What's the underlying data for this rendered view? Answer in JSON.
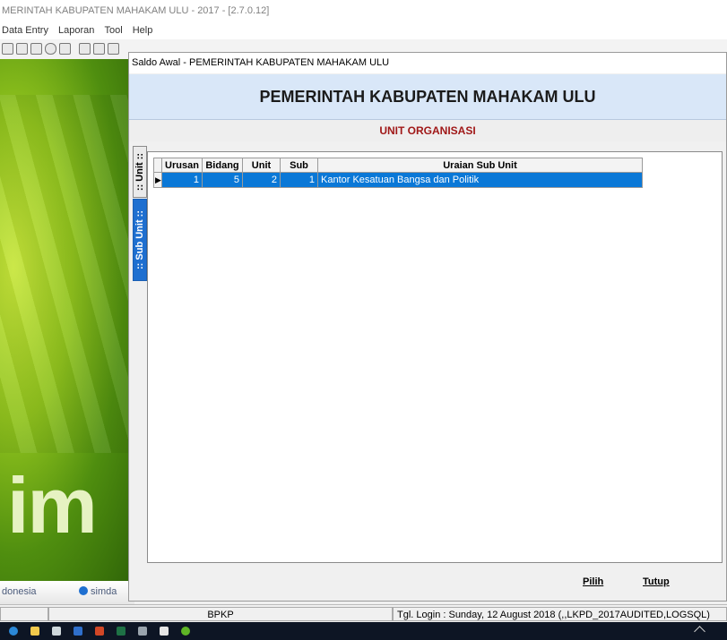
{
  "app": {
    "title": "MERINTAH KABUPATEN MAHAKAM ULU - 2017 - [2.7.0.12]",
    "menu": [
      "Data Entry",
      "Laporan",
      "Tool",
      "Help"
    ]
  },
  "desktop": {
    "logo_text": "im",
    "footer_left": "donesia",
    "footer_right": "simda"
  },
  "dialog": {
    "title": "Saldo Awal - PEMERINTAH KABUPATEN MAHAKAM ULU",
    "header": "PEMERINTAH KABUPATEN MAHAKAM ULU",
    "section": "UNIT ORGANISASI",
    "tabs": [
      ":: Unit ::",
      ":: Sub Unit ::"
    ],
    "active_tab": ":: Sub Unit ::",
    "grid": {
      "columns": [
        "Urusan",
        "Bidang",
        "Unit",
        "Sub",
        "Uraian Sub Unit"
      ],
      "rows": [
        {
          "urusan": "1",
          "bidang": "5",
          "unit": "2",
          "sub": "1",
          "uraian": "Kantor Kesatuan Bangsa dan Politik"
        }
      ]
    },
    "buttons": {
      "pilih": "Pilih",
      "tutup": "Tutup"
    }
  },
  "status": {
    "bpkp": "BPKP",
    "login": "Tgl. Login : Sunday, 12 August 2018 (,,LKPD_2017AUDITED,LOGSQL)"
  },
  "colors": {
    "selection": "#0a78d7",
    "header_band": "#d9e7f8",
    "section_text": "#a01818",
    "active_tab": "#1e6fd0"
  }
}
